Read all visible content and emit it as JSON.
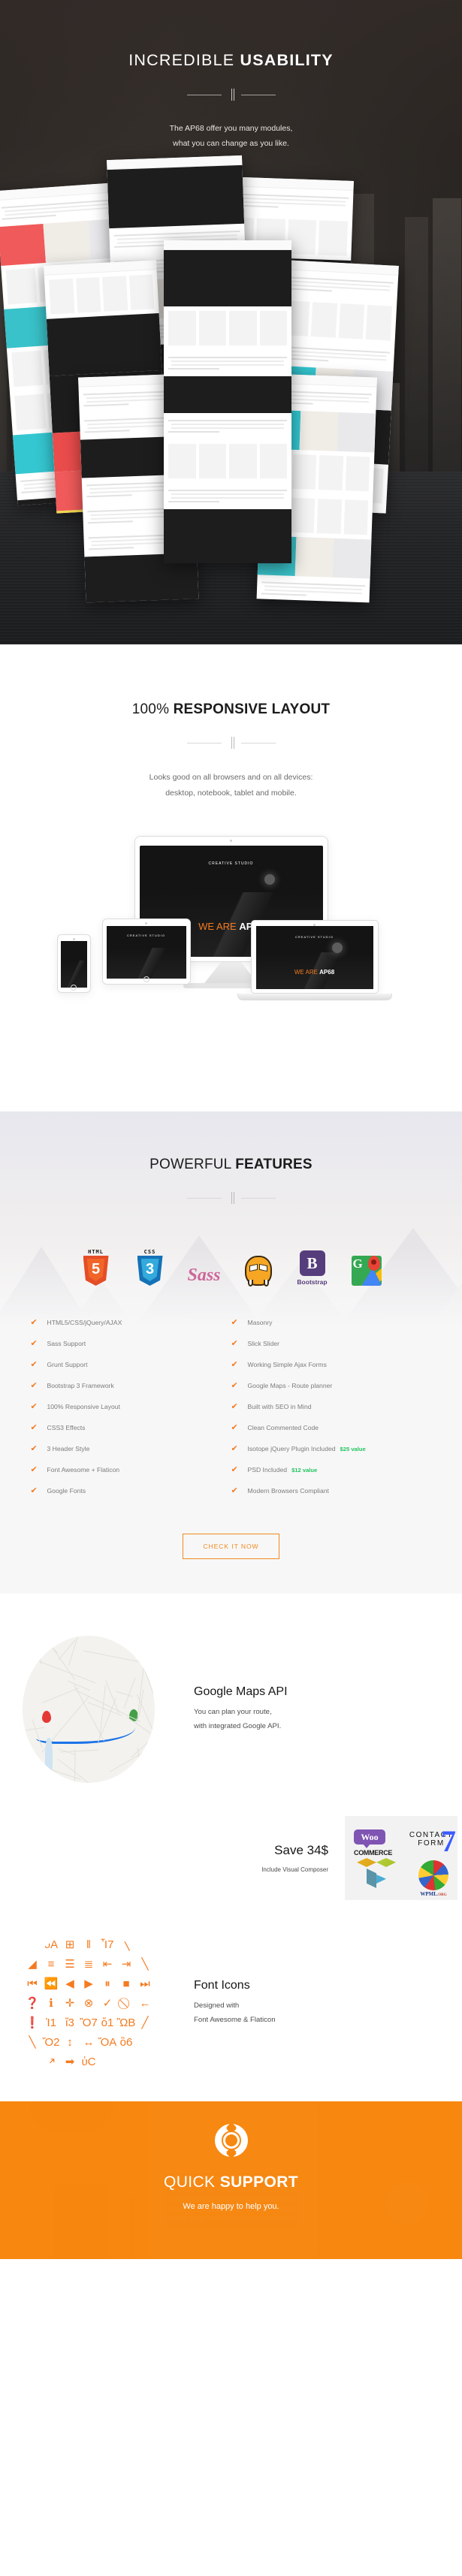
{
  "hero": {
    "title_light": "INCREDIBLE ",
    "title_bold": "USABILITY",
    "sub_line1": "The AP68 offer you many modules,",
    "sub_line2": "what you can change as you like."
  },
  "responsive": {
    "title_light": "100% ",
    "title_bold": "RESPONSIVE LAYOUT",
    "sub_line1": "Looks good on all browsers and on all devices:",
    "sub_line2": "desktop, notebook, tablet and mobile.",
    "device_tagline_light": "WE ARE ",
    "device_tagline_bold": "AP68",
    "device_brand": "CREATIVE STUDIO"
  },
  "features": {
    "title_light": "POWERFUL ",
    "title_bold": "FEATURES",
    "logos": [
      {
        "name": "html5-logo",
        "cap": "HTML",
        "num": "5",
        "color": "#e44d26",
        "inner": "#f16529"
      },
      {
        "name": "css3-logo",
        "cap": "CSS",
        "num": "3",
        "color": "#1572b6",
        "inner": "#33a9dc"
      },
      {
        "name": "sass-logo",
        "label": "Sass"
      },
      {
        "name": "grunt-logo",
        "label": ""
      },
      {
        "name": "bootstrap-logo",
        "mark": "B",
        "label": "Bootstrap"
      },
      {
        "name": "google-maps-logo",
        "mark": "G"
      }
    ],
    "left_column": [
      {
        "label": "HTML5/CSS/jQuery/AJAX",
        "value": ""
      },
      {
        "label": "Sass Support",
        "value": ""
      },
      {
        "label": "Grunt Support",
        "value": ""
      },
      {
        "label": "Bootstrap 3 Framework",
        "value": ""
      },
      {
        "label": "100% Responsive Layout",
        "value": ""
      },
      {
        "label": "CSS3 Effects",
        "value": ""
      },
      {
        "label": "3 Header Style",
        "value": ""
      },
      {
        "label": "Font Awesome + Flaticon",
        "value": ""
      },
      {
        "label": "Google Fonts",
        "value": ""
      }
    ],
    "right_column": [
      {
        "label": "Masonry",
        "value": ""
      },
      {
        "label": "Slick Slider",
        "value": ""
      },
      {
        "label": "Working Simple Ajax Forms",
        "value": ""
      },
      {
        "label": "Google Maps - Route planner",
        "value": ""
      },
      {
        "label": "Built with SEO in Mind",
        "value": ""
      },
      {
        "label": "Clean Commented Code",
        "value": ""
      },
      {
        "label": "Isotope jQuery Plugin Included",
        "value": "$25 value"
      },
      {
        "label": "PSD Included",
        "value": "$12 value"
      },
      {
        "label": "Modern Browsers Compliant",
        "value": ""
      }
    ],
    "cta_label": "CHECK IT NOW",
    "check_glyph": "✔",
    "accent_color": "#f47b20",
    "value_color": "#22c55e"
  },
  "promos": {
    "maps": {
      "title": "Google Maps API",
      "line1": "You can plan your route,",
      "line2": "with integrated Google API."
    },
    "save": {
      "title": "Save 34$",
      "subtitle": "Include Visual Composer",
      "plugins": {
        "woo_top": "Woo",
        "woo_bottom": "COMMERCE",
        "cf_line1": "CONTACT",
        "cf_line2": "FORM",
        "cf_seven": "7",
        "wpml_name": "WPML",
        "wpml_tld": ".ORG"
      }
    },
    "icons": {
      "title": "Font Icons",
      "line1": "Designed with",
      "line2": "Font Awesome & Flaticon",
      "glyphs": [
        "◂",
        "ὐA",
        "⊞",
        "‖",
        "Ἷ7",
        "╲",
        "",
        "◢",
        "≡",
        "☰",
        "≣",
        "⇤",
        "⇥",
        "╲",
        "⏮",
        "⏪",
        "◀",
        "▶",
        "⏸",
        "■",
        "⏭",
        "❓",
        "ℹ",
        "✛",
        "⊗",
        "✓",
        "⃠",
        "←",
        "❗",
        "Ἰ1",
        "ἴ3",
        "Ὂ7",
        "ὄ1",
        "ὪB",
        "╱",
        "╲",
        "Ὄ2",
        "↕",
        "↔",
        "ὌA",
        "ὂ6",
        "",
        "",
        "↗",
        "➡",
        "ὐC",
        "",
        "",
        ""
      ]
    }
  },
  "support": {
    "title_light": "QUICK ",
    "title_bold": "SUPPORT",
    "subtitle": "We are happy to help you.",
    "accent_color": "#f7870f"
  }
}
